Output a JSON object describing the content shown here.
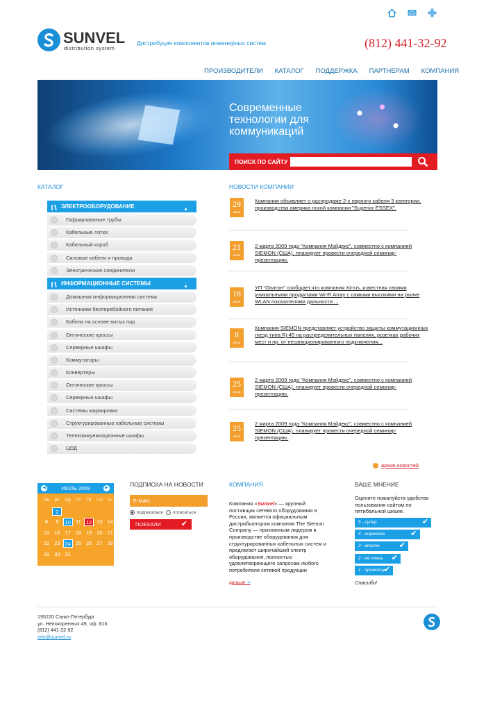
{
  "header": {
    "logo_name": "SUNVEL",
    "logo_sub": "distribution system",
    "tagline": "Дистрибуция компонентов инженерных систем",
    "phone": "(812) 441-32-92",
    "icons": [
      "home-icon",
      "mail-icon",
      "sitemap-icon"
    ]
  },
  "nav": [
    "ПРОИЗВОДИТЕЛИ",
    "КАТАЛОГ",
    "ПОДДЕРЖКА",
    "ПАРТНЕРАМ",
    "КОМПАНИЯ"
  ],
  "banner": {
    "text": "Современные технологии для коммуникаций",
    "search_label": "ПОИСК ПО САЙТУ",
    "search_value": ""
  },
  "catalog": {
    "title": "КАТАЛОГ",
    "groups": [
      {
        "label": "ЭЛЕКТРООБОРУДОВАНИЕ",
        "items": [
          "Гофрированные трубы",
          "Кабельные лотки",
          "Кабельный короб",
          "Силовые кабели и провода",
          "Электрические соединители"
        ]
      },
      {
        "label": "ИНФОРМАЦИОННЫЕ СИСТЕМЫ",
        "items": [
          "Домашняя информационная система",
          "Источники бесперебойного питания",
          "Кабели на основе витых пар",
          "Оптические кроссы",
          "Серверные шкафы",
          "Коммутаторы",
          "Конвертеры",
          "Оптические кроссы",
          "Серверные шкафы",
          "Системы маркировки",
          "Структурированные кабельные системы",
          "Телекоммуникационные шкафы",
          "ЦОД"
        ]
      }
    ]
  },
  "news": {
    "title": "НОВОСТИ КОМПАНИИ",
    "items": [
      {
        "day": "29",
        "month": "июль",
        "text": "Компания объявляет о распродаже 2-х парного кабеля 3 категории, производства америка нской компании \"Superior ESSEX\"."
      },
      {
        "day": "21",
        "month": "июль",
        "text": "2 марта 2009 года \"Компания Мэйдекс\", совместно с компанией SIEMON (США), планирует провести очередной семинар-презентацию."
      },
      {
        "day": "18",
        "month": "июль",
        "text": "УП \"Опатон\" сообщает,что компания Xirrus, известная своими уникальными продуктами Wi-Fi Array с самыми высокими на рынке WLAN показателями дальности ..."
      },
      {
        "day": "8",
        "month": "июль",
        "text": "Компания SIEMON представляет устройство защиты коммутационных гнезд типа Rj-45 на распределительных панелях, розетках рабочих мест и пр. от несанкционированного подключения..."
      },
      {
        "day": "25",
        "month": "июль",
        "text": "2 марта 2009 года \"Компания Мэйдекс\", совместно с компанией SIEMON (США), планирует провести очередной семинар-презентацию."
      },
      {
        "day": "25",
        "month": "июль",
        "text": "2 марта 2009 года \"Компания Мэйдекс\", совместно с компанией SIEMON (США), планирует провести очередной семинар-презентацию."
      }
    ],
    "archive_label": "архив новостей"
  },
  "calendar": {
    "title": "ИЮЛЬ 2009",
    "weekdays": [
      "Пн",
      "Вт",
      "Ср",
      "Чт",
      "Пт",
      "Сб",
      "Вс"
    ],
    "weeks": [
      [
        "",
        "2",
        "",
        "",
        "",
        "",
        ""
      ],
      [
        "8",
        "9",
        "10",
        "11",
        "12",
        "13",
        "14"
      ],
      [
        "15",
        "16",
        "17",
        "18",
        "19",
        "20",
        "21"
      ],
      [
        "22",
        "23",
        "24",
        "25",
        "26",
        "27",
        "28"
      ],
      [
        "29",
        "30",
        "31",
        "",
        "",
        "",
        ""
      ]
    ],
    "highlight_blue": [
      "2",
      "10",
      "24"
    ],
    "highlight_red": [
      "12"
    ]
  },
  "subscribe": {
    "title": "ПОДПИСКА НА НОВОСТИ",
    "email_placeholder": "E-MAIL",
    "radio_subscribe": "подписаться",
    "radio_unsubscribe": "отписаться",
    "button": "ПОЕХАЛИ"
  },
  "company": {
    "title": "КОМПАНИЯ",
    "text_before": "Компания «",
    "brand": "Sunvel",
    "text_after": "» — крупный поставщик сетевого оборудования в России, является официальным дистрибьютором компании The Siemon Company — признанным лидером в производстве оборудования для структурированных кабельных систем и предлагает широчайший спектр оборудования, полностью удовлетворяющего запросам любого потребителя сетевой продукции",
    "more": "дальше"
  },
  "opinion": {
    "title": "ВАШЕ МНЕНИЕ",
    "question": "Оцените пожалуйста удобство пользования сайтом по пятибальной шкале.",
    "options": [
      {
        "label": "5 - супер",
        "level": 1.0
      },
      {
        "label": "4 - нормалек",
        "level": 0.85
      },
      {
        "label": "3 - вполне",
        "level": 0.7
      },
      {
        "label": "2 - не очень",
        "level": 0.6
      },
      {
        "label": "1 - промолчу",
        "level": 0.5
      }
    ],
    "thanks": "Спасибо!"
  },
  "footer": {
    "line1": "195220 Санкт-Петербург",
    "line2": "ул. Непокоренных 49, оф. 816",
    "line3": "(812) 441-32-92",
    "email": "info@sunvel.ru"
  }
}
